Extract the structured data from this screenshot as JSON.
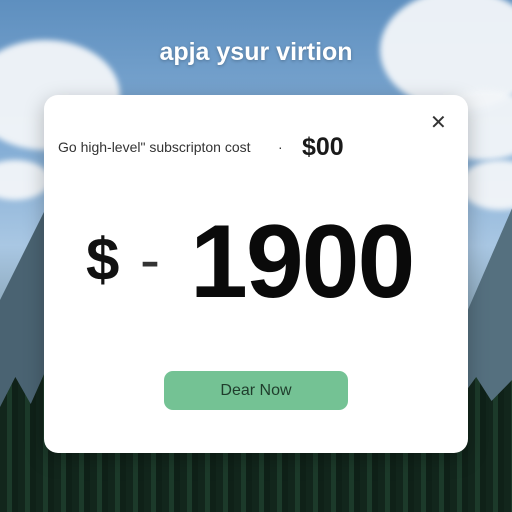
{
  "header": {
    "title": "apja ysur virtion"
  },
  "dialog": {
    "close_icon": "close-icon",
    "subtitle": "Go high-level\" subscripton cost",
    "separator": "·",
    "small_price": "$00",
    "currency": "$",
    "dash": "-",
    "amount": "1900",
    "cta_label": "Dear Now"
  },
  "colors": {
    "card_bg": "#ffffff",
    "cta_bg": "#74c294",
    "cta_text": "#1f3d2c",
    "headline_text": "#ffffff"
  }
}
